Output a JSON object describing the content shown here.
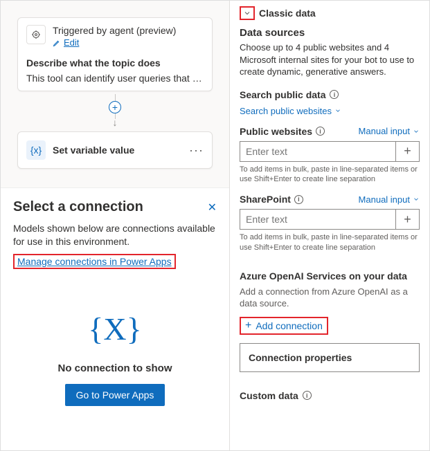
{
  "canvas": {
    "trigger_title": "Triggered by agent (preview)",
    "edit_label": "Edit",
    "describe_label": "Describe what the topic does",
    "describe_text": "This tool can identify user queries that seek f...",
    "set_var_label": "Set variable value"
  },
  "conn": {
    "title": "Select a connection",
    "desc": "Models shown below are connections available for use in this environment.",
    "manage_label": "Manage connections in Power Apps",
    "placeholder_icon": "{X}",
    "empty_label": "No connection to show",
    "go_button": "Go to Power Apps"
  },
  "right": {
    "classic_label": "Classic data",
    "ds_title": "Data sources",
    "ds_desc": "Choose up to 4 public websites and 4 Microsoft internal sites for your bot to use to create dynamic, generative answers.",
    "search_public_label": "Search public data",
    "search_public_link": "Search public websites",
    "public_sites_label": "Public websites",
    "manual_input_label": "Manual input",
    "input_placeholder": "Enter text",
    "bulk_hint": "To add items in bulk, paste in line-separated items or use Shift+Enter to create line separation",
    "sharepoint_label": "SharePoint",
    "azure_label": "Azure OpenAI Services on your data",
    "azure_desc": "Add a connection from Azure OpenAI as a data source.",
    "add_connection_label": "Add connection",
    "conn_props_label": "Connection properties",
    "custom_data_label": "Custom data"
  }
}
